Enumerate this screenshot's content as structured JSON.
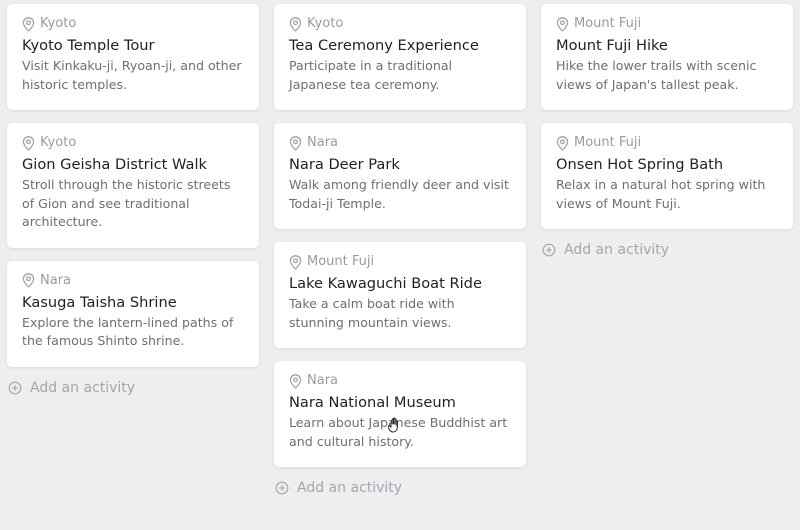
{
  "columns": [
    {
      "cards": [
        {
          "location": "Kyoto",
          "title": "Kyoto Temple Tour",
          "description": "Visit Kinkaku-ji, Ryoan-ji, and other historic temples."
        },
        {
          "location": "Kyoto",
          "title": "Gion Geisha District Walk",
          "description": "Stroll through the historic streets of Gion and see traditional architecture."
        },
        {
          "location": "Nara",
          "title": "Kasuga Taisha Shrine",
          "description": "Explore the lantern-lined paths of the famous Shinto shrine."
        }
      ],
      "add_label": "Add an activity"
    },
    {
      "cards": [
        {
          "location": "Kyoto",
          "title": "Tea Ceremony Experience",
          "description": "Participate in a traditional Japanese tea ceremony."
        },
        {
          "location": "Nara",
          "title": "Nara Deer Park",
          "description": "Walk among friendly deer and visit Todai-ji Temple."
        },
        {
          "location": "Mount Fuji",
          "title": "Lake Kawaguchi Boat Ride",
          "description": "Take a calm boat ride with stunning mountain views."
        },
        {
          "location": "Nara",
          "title": "Nara National Museum",
          "description": "Learn about Japanese Buddhist art and cultural history."
        }
      ],
      "add_label": "Add an activity"
    },
    {
      "cards": [
        {
          "location": "Mount Fuji",
          "title": "Mount Fuji Hike",
          "description": "Hike the lower trails with scenic views of Japan's tallest peak."
        },
        {
          "location": "Mount Fuji",
          "title": "Onsen Hot Spring Bath",
          "description": "Relax in a natural hot spring with views of Mount Fuji."
        }
      ],
      "add_label": "Add an activity"
    }
  ],
  "icons": {
    "location": "map-pin-icon",
    "add": "plus-circle-icon"
  },
  "colors": {
    "background": "#eeeef1",
    "card": "#ffffff",
    "title": "#1f2023",
    "muted": "#9a9aa2"
  }
}
